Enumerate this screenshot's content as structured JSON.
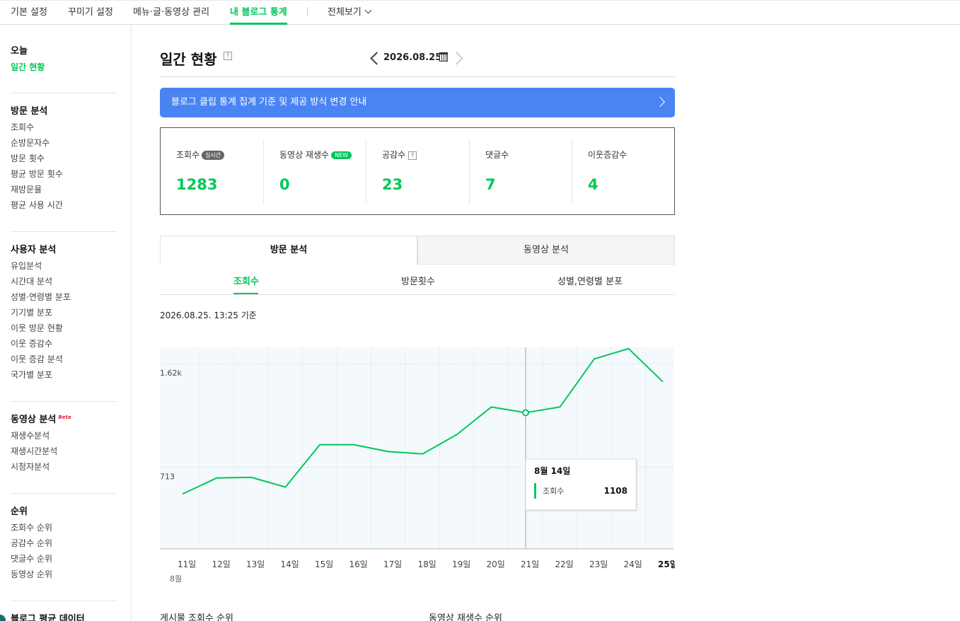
{
  "topnav": {
    "tabs": [
      {
        "label": "기본 설정"
      },
      {
        "label": "꾸미기 설정"
      },
      {
        "label": "메뉴·글·동영상 관리"
      },
      {
        "label": "내 블로그 통계"
      }
    ],
    "more_label": "전체보기"
  },
  "sidebar": {
    "today": {
      "title": "오늘",
      "items": [
        "일간 현황"
      ]
    },
    "visit": {
      "title": "방문 분석",
      "items": [
        "조회수",
        "순방문자수",
        "방문 횟수",
        "평균 방문 횟수",
        "재방문율",
        "평균 사용 시간"
      ]
    },
    "user": {
      "title": "사용자 분석",
      "items": [
        "유입분석",
        "시간대 분석",
        "성별·연령별 분포",
        "기기별 분포",
        "이웃 방문 현황",
        "이웃 증감수",
        "이웃 증감 분석",
        "국가별 분포"
      ]
    },
    "video": {
      "title": "동영상 분석",
      "beta": "Beta",
      "items": [
        "재생수분석",
        "재생시간분석",
        "시청자분석"
      ]
    },
    "rank": {
      "title": "순위",
      "items": [
        "조회수 순위",
        "공감수 순위",
        "댓글수 순위",
        "동영상 순위"
      ]
    },
    "avg": {
      "title": "블로그 평균 데이터"
    }
  },
  "main": {
    "title": "일간 현황",
    "help": "?",
    "date": "2026.08.25.",
    "notice": "블로그 클립 통계 집계 기준 및 제공 방식 변경 안내",
    "stats": [
      {
        "label": "조회수",
        "badge": "실시간",
        "value": "1283"
      },
      {
        "label": "동영상 재생수",
        "badge": "NEW",
        "value": "0"
      },
      {
        "label": "공감수",
        "help": "?",
        "value": "23"
      },
      {
        "label": "댓글수",
        "value": "7"
      },
      {
        "label": "이웃증감수",
        "value": "4"
      }
    ],
    "big_tabs": [
      "방문 분석",
      "동영상 분석"
    ],
    "sub_tabs": [
      "조회수",
      "방문횟수",
      "성별,연령별 분포"
    ],
    "as_of": "2026.08.25. 13:25 기준",
    "bottom_headings": [
      "게시물 조회수 순위",
      "동영상 재생수 순위"
    ]
  },
  "chart_data": {
    "type": "line",
    "x_month_label": "8월",
    "categories": [
      "11일",
      "12일",
      "13일",
      "14일",
      "15일",
      "16일",
      "17일",
      "18일",
      "19일",
      "20일",
      "21일",
      "22일",
      "23일",
      "24일",
      "25일"
    ],
    "series": [
      {
        "name": "조회수",
        "values": [
          480,
          620,
          625,
          540,
          910,
          910,
          850,
          830,
          1000,
          1240,
          1190,
          1240,
          1660,
          1750,
          1460
        ]
      }
    ],
    "y_ticks": [
      {
        "value": 713,
        "label": "713"
      },
      {
        "value": 1620,
        "label": "1.62k"
      }
    ],
    "ylim": [
      0,
      1700
    ],
    "color": "#03c75a",
    "tooltip": {
      "title": "8월 14일",
      "series": "조회수",
      "value": "1108",
      "index": 10
    },
    "highlight_last": true
  }
}
